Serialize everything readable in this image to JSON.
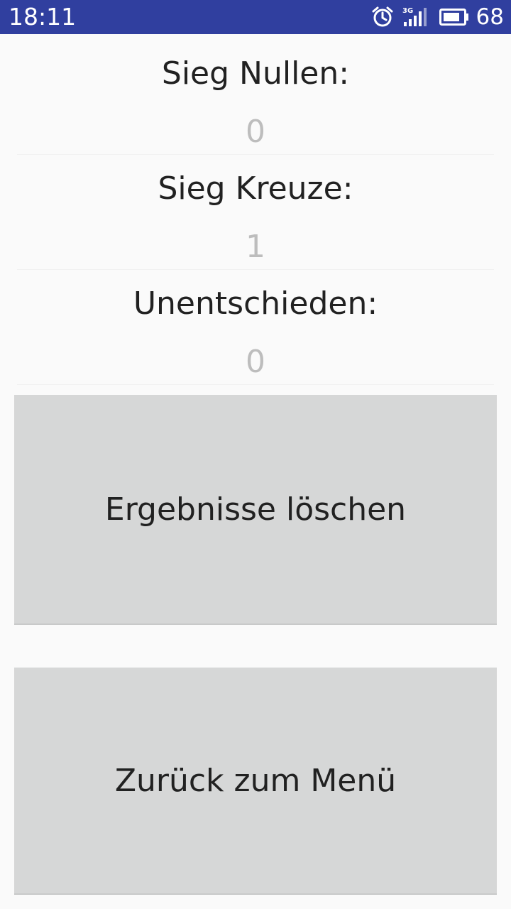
{
  "status_bar": {
    "time": "18:11",
    "network": "3G",
    "battery_level": "68",
    "background_color": "#303f9f"
  },
  "stats": [
    {
      "label": "Sieg Nullen:",
      "value": "0"
    },
    {
      "label": "Sieg Kreuze:",
      "value": "1"
    },
    {
      "label": "Unentschieden:",
      "value": "0"
    }
  ],
  "buttons": {
    "clear_results": "Ergebnisse löschen",
    "back_to_menu": "Zurück zum Menü"
  },
  "icons": {
    "alarm": "alarm-clock-icon",
    "signal": "cellular-signal-icon",
    "battery": "battery-icon"
  }
}
